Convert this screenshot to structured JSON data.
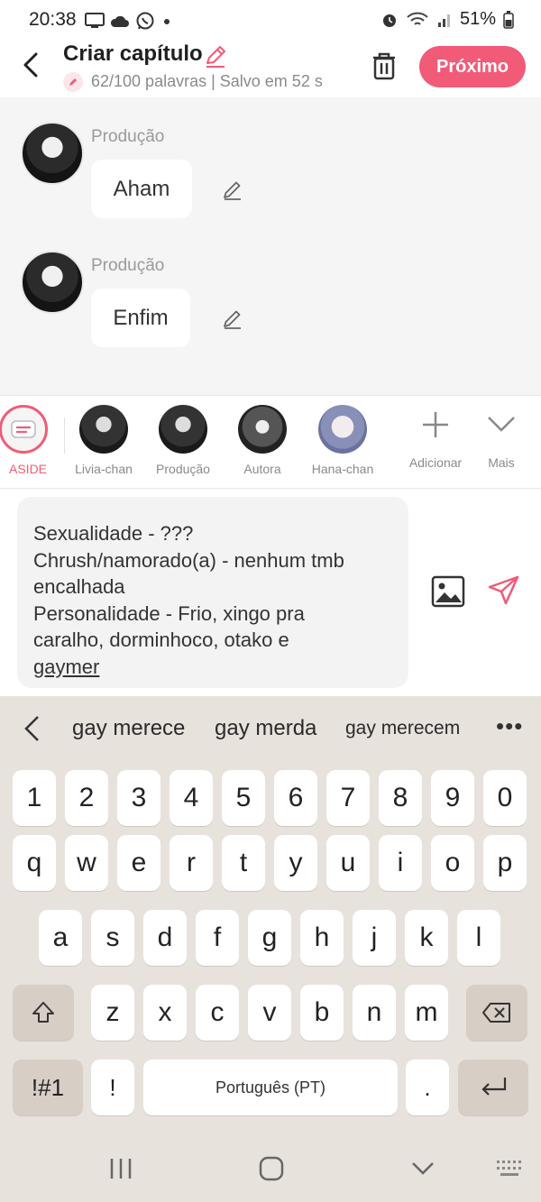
{
  "status": {
    "time": "20:38",
    "battery": "51%"
  },
  "header": {
    "title": "Criar capítulo",
    "word_count": "62/100 palavras | Salvo em 52 s",
    "next_label": "Próximo"
  },
  "messages": [
    {
      "name": "Produção",
      "text": "Aham"
    },
    {
      "name": "Produção",
      "text": "Enfim"
    }
  ],
  "characters": {
    "items": [
      {
        "label": "ASIDE"
      },
      {
        "label": "Livia-chan"
      },
      {
        "label": "Produção"
      },
      {
        "label": "Autora"
      },
      {
        "label": "Hana-chan"
      }
    ],
    "add_label": "Adicionar",
    "more_label": "Mais"
  },
  "composer": {
    "lines": [
      "Sexualidade - ???",
      "Chrush/namorado(a) - nenhum tmb",
      "encalhada",
      "Personalidade - Frio, xingo pra",
      "caralho, dorminhoco, otako e"
    ],
    "last_word": "gaymer"
  },
  "keyboard": {
    "suggestions": [
      "gay merece",
      "gay merda",
      "gay merecem"
    ],
    "more": "•••",
    "row_numbers": [
      "1",
      "2",
      "3",
      "4",
      "5",
      "6",
      "7",
      "8",
      "9",
      "0"
    ],
    "row_q": [
      "q",
      "w",
      "e",
      "r",
      "t",
      "y",
      "u",
      "i",
      "o",
      "p"
    ],
    "row_a": [
      "a",
      "s",
      "d",
      "f",
      "g",
      "h",
      "j",
      "k",
      "l"
    ],
    "row_z": [
      "z",
      "x",
      "c",
      "v",
      "b",
      "n",
      "m"
    ],
    "symbols_label": "!#1",
    "exclaim_label": "!",
    "space_label": "Português (PT)",
    "period_label": "."
  },
  "colors": {
    "accent": "#f15b78",
    "keyboard_bg": "#e8e2dd"
  }
}
